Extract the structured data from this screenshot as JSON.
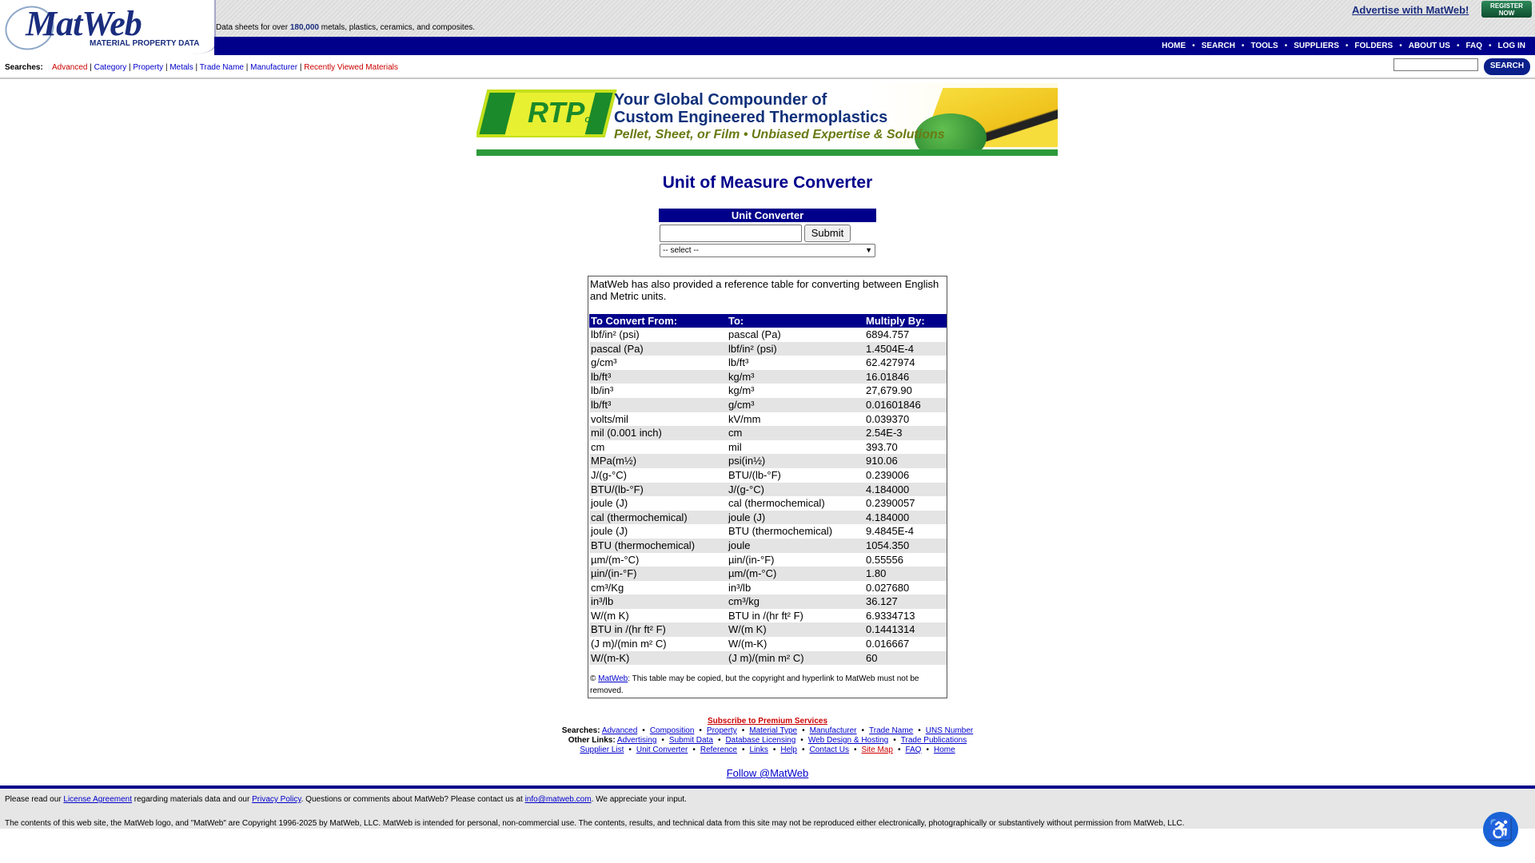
{
  "header": {
    "logo_text": "MatWeb",
    "logo_sub": "MATERIAL PROPERTY DATA",
    "tagline_pre": "Data sheets for over ",
    "tagline_count": "180,000",
    "tagline_post": " metals, plastics, ceramics, and composites.",
    "advertise": "Advertise with MatWeb!",
    "register_line1": "REGISTER",
    "register_line2": "NOW",
    "nav": [
      "HOME",
      "SEARCH",
      "TOOLS",
      "SUPPLIERS",
      "FOLDERS",
      "ABOUT US",
      "FAQ",
      "LOG IN"
    ]
  },
  "searchbar": {
    "label": "Searches:",
    "links": [
      "Advanced",
      "Category",
      "Property",
      "Metals",
      "Trade Name",
      "Manufacturer",
      "Recently Viewed Materials"
    ],
    "button": "SEARCH"
  },
  "banner": {
    "logo": "RTP",
    "logo_co": "Co.",
    "line1": "Your Global Compounder of",
    "line2": "Custom Engineered Thermoplastics",
    "line3": "Pellet, Sheet, or Film • Unbiased Expertise & Solutions"
  },
  "page_title": "Unit of Measure Converter",
  "converter": {
    "heading": "Unit Converter",
    "input_value": "",
    "submit": "Submit",
    "select_value": "-- select --"
  },
  "reference": {
    "intro": "MatWeb has also provided a reference table for converting between English and Metric units.",
    "headers": [
      "To Convert From:",
      "To:",
      "Multiply By:"
    ],
    "rows": [
      [
        "lbf/in² (psi)",
        "pascal (Pa)",
        "6894.757"
      ],
      [
        "pascal (Pa)",
        "lbf/in² (psi)",
        "1.4504E-4"
      ],
      [
        "g/cm³",
        "lb/ft³",
        "62.427974"
      ],
      [
        "lb/ft³",
        "kg/m³",
        "16.01846"
      ],
      [
        "lb/in³",
        "kg/m³",
        "27,679.90"
      ],
      [
        "lb/ft³",
        "g/cm³",
        "0.01601846"
      ],
      [
        "volts/mil",
        "kV/mm",
        "0.039370"
      ],
      [
        "mil (0.001 inch)",
        "cm",
        "2.54E-3"
      ],
      [
        "cm",
        "mil",
        "393.70"
      ],
      [
        "MPa(m½)",
        "psi(in½)",
        "910.06"
      ],
      [
        "J/(g-°C)",
        "BTU/(lb-°F)",
        "0.239006"
      ],
      [
        "BTU/(lb-°F)",
        "J/(g-°C)",
        "4.184000"
      ],
      [
        "joule (J)",
        "cal (thermochemical)",
        "0.2390057"
      ],
      [
        "cal (thermochemical)",
        "joule (J)",
        "4.184000"
      ],
      [
        "joule (J)",
        "BTU (thermochemical)",
        "9.4845E-4"
      ],
      [
        "BTU (thermochemical)",
        "joule",
        "1054.350"
      ],
      [
        "µm/(m-°C)",
        "µin/(in-°F)",
        "0.55556"
      ],
      [
        "µin/(in-°F)",
        "µm/(m-°C)",
        "1.80"
      ],
      [
        "cm³/Kg",
        "in³/lb",
        "0.027680"
      ],
      [
        "in³/lb",
        "cm³/kg",
        "36.127"
      ],
      [
        "W/(m K)",
        "BTU in /(hr ft²  F)",
        "6.9334713"
      ],
      [
        "BTU in /(hr ft²  F)",
        "W/(m K)",
        "0.1441314"
      ],
      [
        "(J m)/(min m²  C)",
        "W/(m-K)",
        "0.016667"
      ],
      [
        "W/(m-K)",
        "(J m)/(min m²  C)",
        "60"
      ]
    ],
    "copyright_pre": "© ",
    "copyright_link": "MatWeb",
    "copyright_post": ":  This table may be copied, but the copyright and hyperlink to MatWeb must not be removed."
  },
  "footer": {
    "premium": "Subscribe to Premium Services",
    "searches_label": "Searches:",
    "searches": [
      "Advanced",
      "Composition",
      "Property",
      "Material Type",
      "Manufacturer",
      "Trade Name",
      "UNS Number"
    ],
    "other_label": "Other Links:",
    "other": [
      "Advertising",
      "Submit Data",
      "Database Licensing",
      "Web Design & Hosting",
      "Trade Publications"
    ],
    "row3": [
      "Supplier List",
      "Unit Converter",
      "Reference",
      "Links",
      "Help",
      "Contact Us",
      "Site Map",
      "FAQ",
      "Home"
    ],
    "follow": "Follow @MatWeb",
    "notice_1": "Please read our ",
    "notice_link1": "License Agreement",
    "notice_2": " regarding materials data and our ",
    "notice_link2": "Privacy Policy",
    "notice_3": ". Questions or comments about MatWeb? Please contact us at ",
    "notice_email": "info@matweb.com",
    "notice_4": ". We appreciate your input.",
    "copyright": "The contents of this web site, the MatWeb logo, and \"MatWeb\" are Copyright 1996-2025 by MatWeb, LLC. MatWeb is intended for personal, non-commercial use. The contents, results, and technical data from this site may not be reproduced either electronically, photographically or substantively without permission from MatWeb, LLC."
  },
  "accessibility_icon": "accessibility-person-icon"
}
